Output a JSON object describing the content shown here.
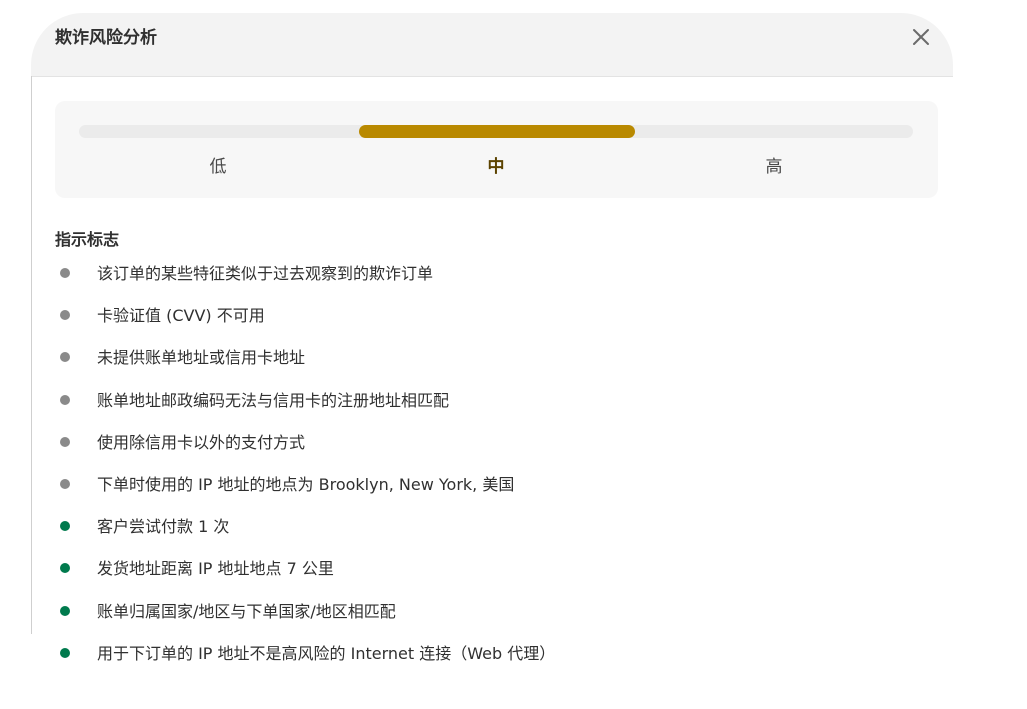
{
  "dialog": {
    "title": "欺诈风险分析",
    "close_icon": "close-icon"
  },
  "risk_meter": {
    "levels": [
      "低",
      "中",
      "高"
    ],
    "current_level": "中",
    "current_level_index": 1,
    "fill_start_fraction": 0.336,
    "fill_end_fraction": 0.667,
    "fill_color": "#b98900",
    "track_color": "#ebebeb"
  },
  "indicators": {
    "title": "指示标志",
    "status_colors": {
      "risk": "#8a8a8a",
      "safe": "#007a4d"
    },
    "items": [
      {
        "text": "该订单的某些特征类似于过去观察到的欺诈订单",
        "status": "risk"
      },
      {
        "text": "卡验证值 (CVV) 不可用",
        "status": "risk"
      },
      {
        "text": "未提供账单地址或信用卡地址",
        "status": "risk"
      },
      {
        "text": "账单地址邮政编码无法与信用卡的注册地址相匹配",
        "status": "risk"
      },
      {
        "text": "使用除信用卡以外的支付方式",
        "status": "risk"
      },
      {
        "text": "下单时使用的 IP 地址的地点为 Brooklyn, New York, 美国",
        "status": "risk"
      },
      {
        "text": "客户尝试付款 1 次",
        "status": "safe"
      },
      {
        "text": "发货地址距离 IP 地址地点 7 公里",
        "status": "safe"
      },
      {
        "text": "账单归属国家/地区与下单国家/地区相匹配",
        "status": "safe"
      },
      {
        "text": "用于下订单的 IP 地址不是高风险的 Internet 连接（Web 代理）",
        "status": "safe"
      }
    ]
  }
}
